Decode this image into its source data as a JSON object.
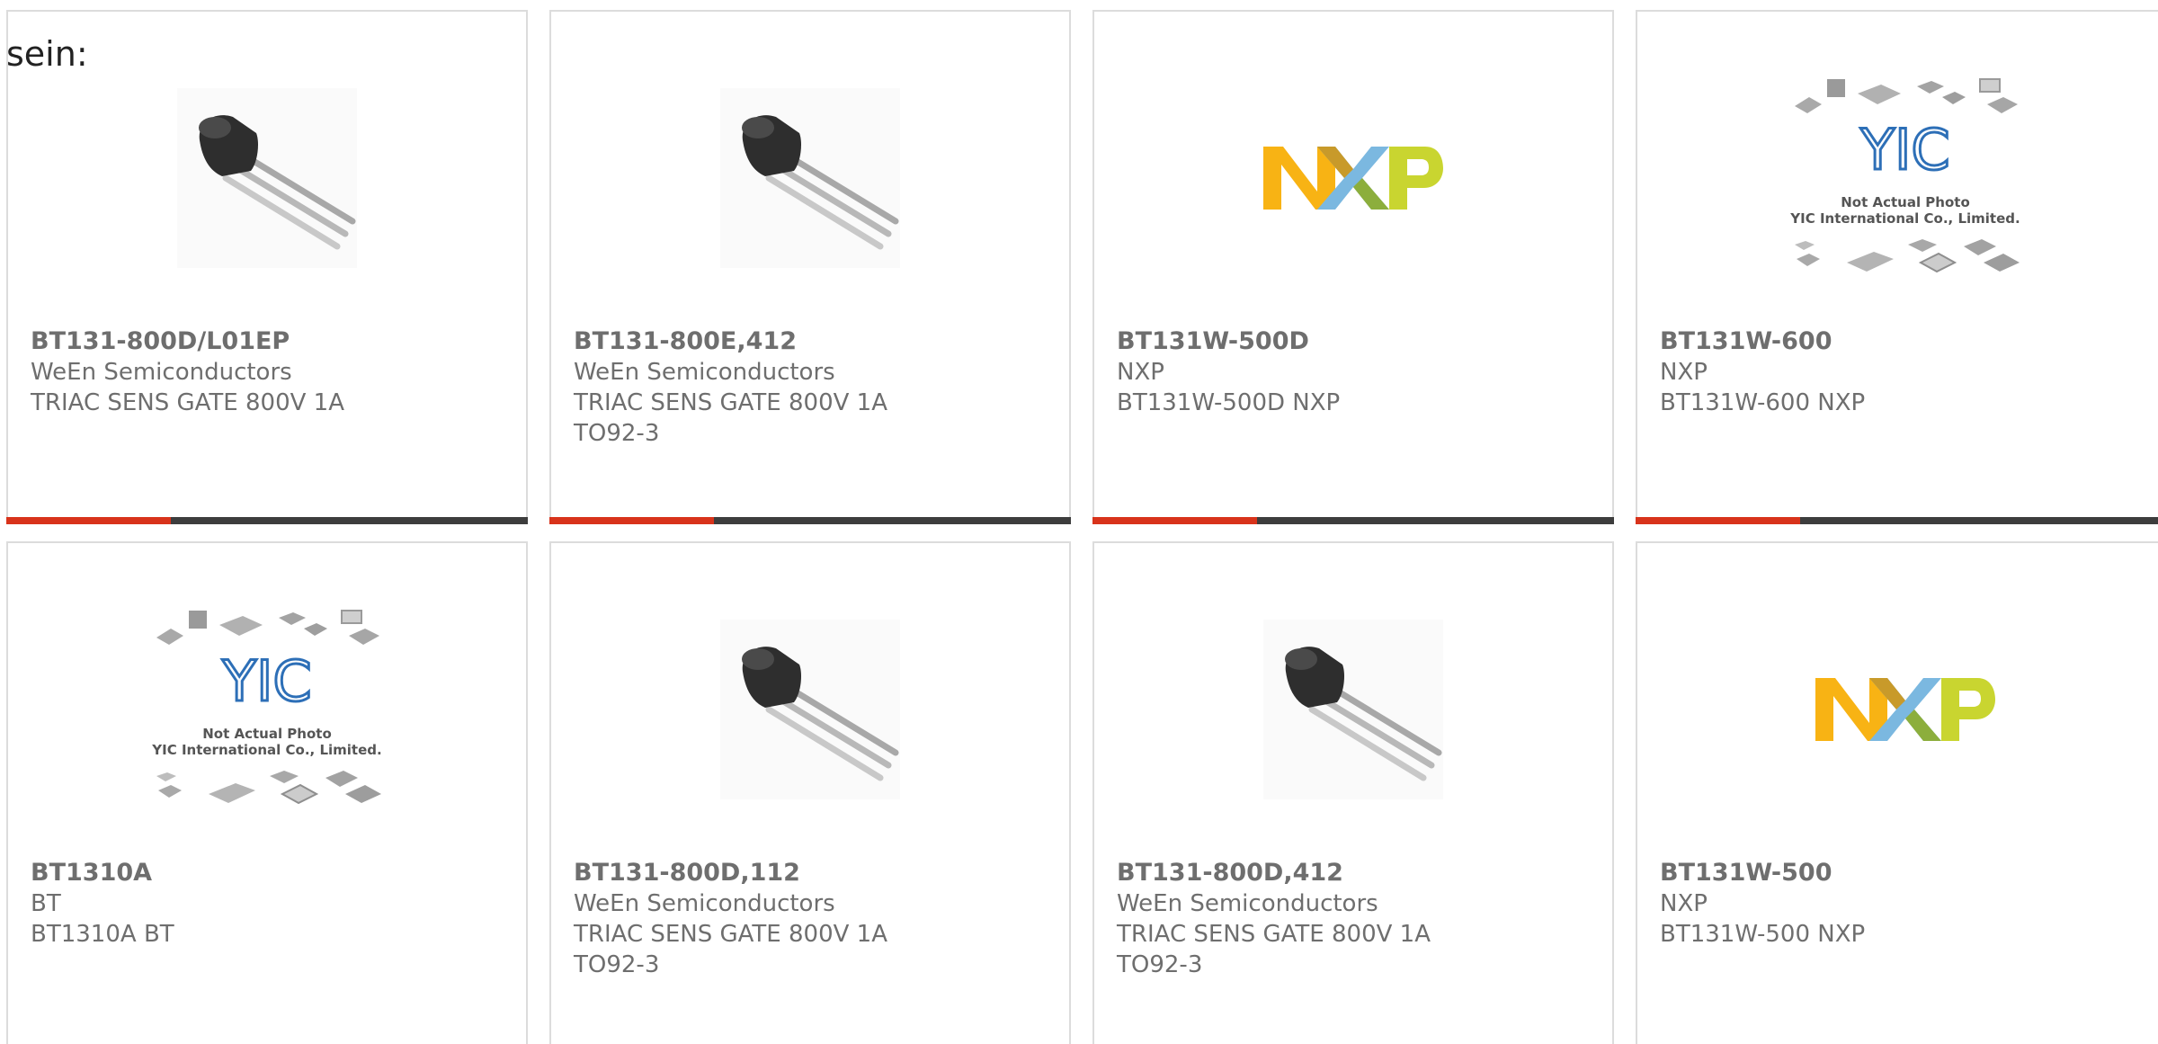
{
  "intro_text": "sein:",
  "colors": {
    "accent": "#d8331b",
    "bar": "#3d3d3d",
    "border": "#dcdcdc",
    "text": "#6e6e6e"
  },
  "cards": [
    {
      "part": "BT131-800D/L01EP",
      "manufacturer": "WeEn Semiconductors",
      "description": "TRIAC SENS GATE 800V 1A",
      "package": "",
      "image": "to92-transistor-icon"
    },
    {
      "part": "BT131-800E,412",
      "manufacturer": "WeEn Semiconductors",
      "description": "TRIAC SENS GATE 800V 1A",
      "package": "TO92-3",
      "image": "to92-transistor-icon"
    },
    {
      "part": "BT131W-500D",
      "manufacturer": "NXP",
      "description": "BT131W-500D NXP",
      "package": "",
      "image": "nxp-logo"
    },
    {
      "part": "BT131W-600",
      "manufacturer": "NXP",
      "description": "BT131W-600 NXP",
      "package": "",
      "image": "yic-placeholder",
      "placeholder_line1": "Not Actual Photo",
      "placeholder_line2": "YIC International Co., Limited.",
      "placeholder_logo": "YIC"
    },
    {
      "part": "BT1310A",
      "manufacturer": "BT",
      "description": "BT1310A BT",
      "package": "",
      "image": "yic-placeholder",
      "placeholder_line1": "Not Actual Photo",
      "placeholder_line2": "YIC International Co., Limited.",
      "placeholder_logo": "YIC"
    },
    {
      "part": "BT131-800D,112",
      "manufacturer": "WeEn Semiconductors",
      "description": "TRIAC SENS GATE 800V 1A",
      "package": "TO92-3",
      "image": "to92-transistor-icon"
    },
    {
      "part": "BT131-800D,412",
      "manufacturer": "WeEn Semiconductors",
      "description": "TRIAC SENS GATE 800V 1A",
      "package": "TO92-3",
      "image": "to92-transistor-icon"
    },
    {
      "part": "BT131W-500",
      "manufacturer": "NXP",
      "description": "BT131W-500 NXP",
      "package": "",
      "image": "nxp-logo"
    }
  ]
}
